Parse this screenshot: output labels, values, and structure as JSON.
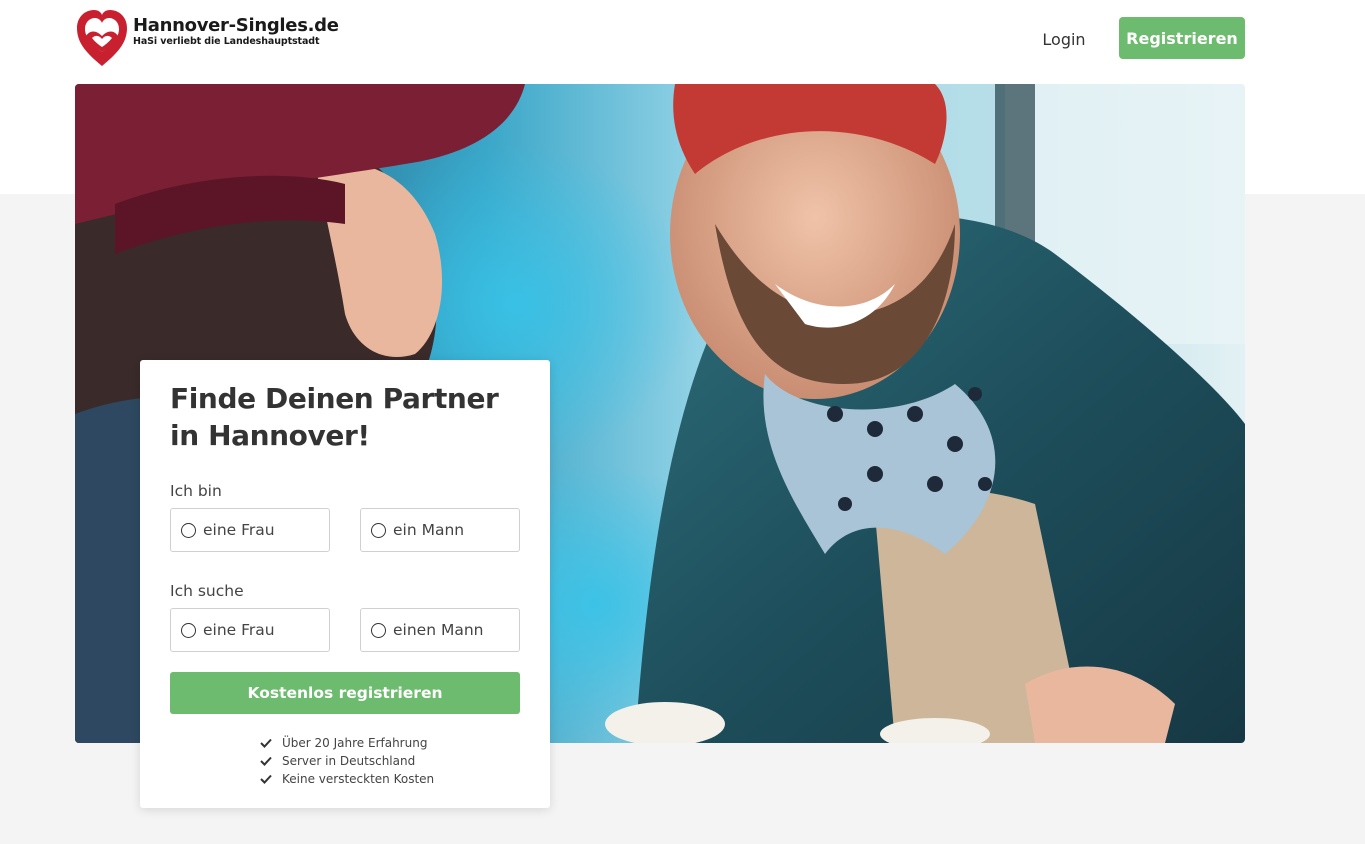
{
  "header": {
    "logo_name": "Hannover-Singles.de",
    "logo_tagline": "HaSi verliebt die Landeshauptstadt",
    "login_label": "Login",
    "register_label": "Registrieren"
  },
  "signup": {
    "title": "Finde Deinen Partner in Hannover!",
    "i_am_label": "Ich bin",
    "i_am_options": [
      "eine Frau",
      "ein Mann"
    ],
    "seeking_label": "Ich suche",
    "seeking_options": [
      "eine Frau",
      "einen Mann"
    ],
    "cta_label": "Kostenlos registrieren",
    "benefits": [
      "Über 20 Jahre Erfahrung",
      "Server in Deutschland",
      "Keine versteckten Kosten"
    ]
  },
  "colors": {
    "brand_green": "#6dbb6e",
    "logo_red": "#c8202f",
    "page_background": "#f4f4f4"
  },
  "icons": {
    "logo": "heart-logo-icon",
    "radio": "radio-unchecked-icon",
    "benefit": "checkmark-icon"
  }
}
